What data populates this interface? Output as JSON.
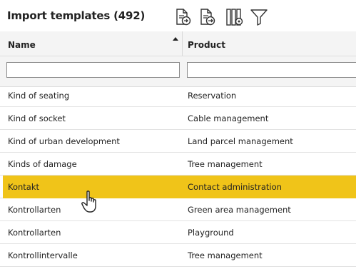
{
  "header": {
    "title": "Import templates (492)",
    "toolbar": [
      {
        "icon": "document-import-icon"
      },
      {
        "icon": "document-export-icon"
      },
      {
        "icon": "column-settings-icon"
      },
      {
        "icon": "filter-icon"
      }
    ]
  },
  "columns": {
    "name": "Name",
    "product": "Product",
    "sort": "ascending"
  },
  "filters": {
    "name_value": "",
    "product_value": ""
  },
  "rows": [
    {
      "name": "Kind of seating",
      "product": "Reservation"
    },
    {
      "name": "Kind of socket",
      "product": "Cable management"
    },
    {
      "name": "Kind of urban development",
      "product": "Land parcel management"
    },
    {
      "name": "Kinds of damage",
      "product": "Tree management"
    },
    {
      "name": "Kontakt",
      "product": "Contact administration",
      "selected": true
    },
    {
      "name": "Kontrollarten",
      "product": "Green area management"
    },
    {
      "name": "Kontrollarten",
      "product": "Playground"
    },
    {
      "name": "Kontrollintervalle",
      "product": "Tree management"
    }
  ],
  "colors": {
    "selected_row": "#f0c419",
    "header_bg": "#f4f4f4"
  }
}
